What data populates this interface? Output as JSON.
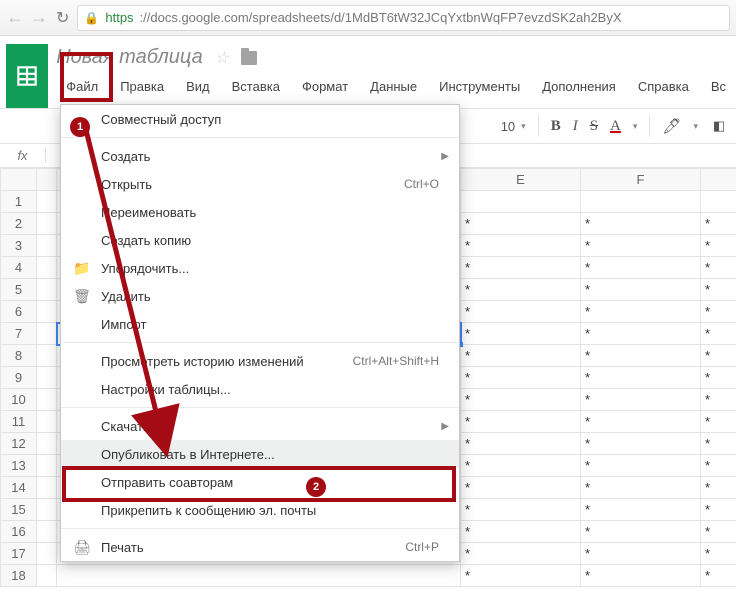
{
  "browser": {
    "url_proto": "https",
    "url_host": "://docs.google.com",
    "url_path": "/spreadsheets/d/1MdBT6tW32JCqYxtbnWqFP7evzdSK2ah2ByX"
  },
  "doc": {
    "title": "Новая таблица"
  },
  "menubar": [
    "Файл",
    "Правка",
    "Вид",
    "Вставка",
    "Формат",
    "Данные",
    "Инструменты",
    "Дополнения",
    "Справка",
    "Вс"
  ],
  "toolbar": {
    "font_size": "10",
    "bold": "B",
    "italic": "I",
    "strike": "S",
    "textcolor": "A"
  },
  "fx": "fx",
  "columns": [
    "",
    "",
    "E",
    "F",
    ""
  ],
  "rows": [
    1,
    2,
    3,
    4,
    5,
    6,
    7,
    8,
    9,
    10,
    11,
    12,
    13,
    14,
    15,
    16,
    17,
    18
  ],
  "cell_value": "*",
  "file_menu": [
    {
      "label": "Совместный доступ",
      "icon": ""
    },
    {
      "sep": true
    },
    {
      "label": "Создать",
      "submenu": true
    },
    {
      "label": "Открыть",
      "shortcut": "Ctrl+O"
    },
    {
      "label": "Переименовать"
    },
    {
      "label": "Создать копию"
    },
    {
      "label": "Упорядочить...",
      "icon": "folder"
    },
    {
      "label": "Удалить",
      "icon": "trash"
    },
    {
      "label": "Импорт"
    },
    {
      "sep": true
    },
    {
      "label": "Просмотреть историю изменений",
      "shortcut": "Ctrl+Alt+Shift+H"
    },
    {
      "label": "Настройки таблицы..."
    },
    {
      "sep": true
    },
    {
      "label": "Скачать как",
      "submenu": true
    },
    {
      "label": "Опубликовать в Интернете...",
      "highlight": true
    },
    {
      "label": "Отправить соавторам"
    },
    {
      "label": "Прикрепить к сообщению эл. почты"
    },
    {
      "sep": true
    },
    {
      "label": "Печать",
      "icon": "print",
      "shortcut": "Ctrl+P"
    }
  ],
  "badges": {
    "one": "1",
    "two": "2"
  }
}
